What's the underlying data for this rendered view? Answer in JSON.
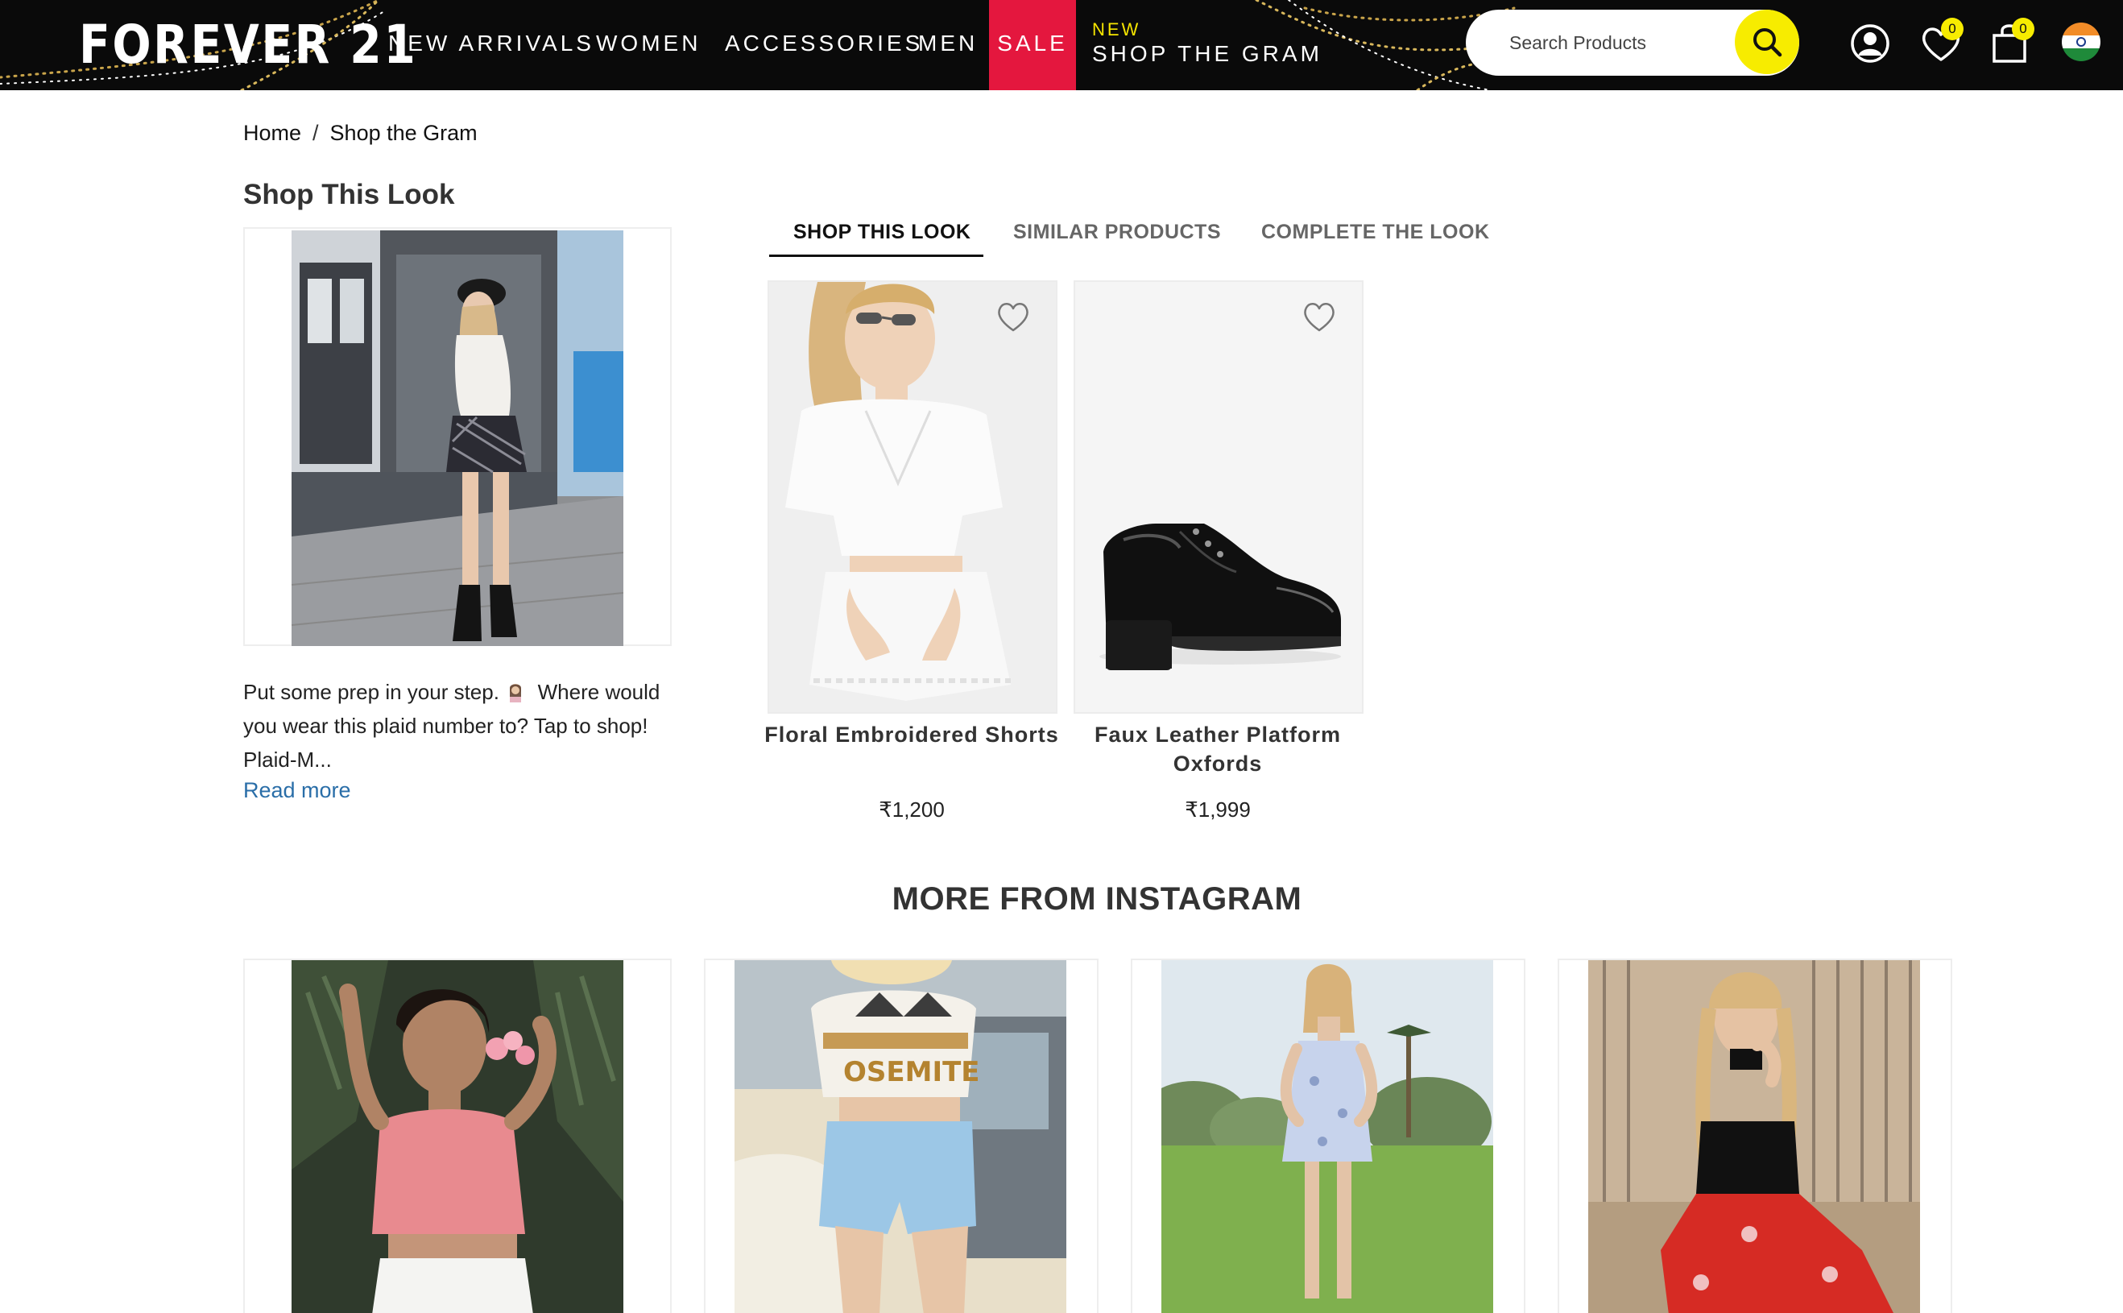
{
  "header": {
    "logo": "FOREVER 21",
    "nav": [
      "NEW ARRIVALS",
      "WOMEN",
      "ACCESSORIES",
      "MEN",
      "SALE"
    ],
    "gram_new": "NEW",
    "gram_label": "SHOP THE GRAM",
    "search_placeholder": "Search Products",
    "wishlist_count": "0",
    "cart_count": "0",
    "icons": [
      "account-icon",
      "wishlist-heart-icon",
      "shopping-bag-icon",
      "india-flag-icon",
      "search-icon"
    ],
    "colors": {
      "bar": "#0a0a0a",
      "sale": "#e4173e",
      "accent": "#f7ec00"
    }
  },
  "breadcrumb": {
    "home": "Home",
    "separator": "/",
    "current": "Shop the Gram"
  },
  "look": {
    "title": "Shop This Look",
    "caption_before": "Put some prep in your step.",
    "caption_after": "Where would you wear this plaid number to? Tap to shop! Plaid-M...",
    "read_more": "Read more"
  },
  "tabs": [
    {
      "label": "SHOP THIS LOOK",
      "active": true
    },
    {
      "label": "SIMILAR PRODUCTS",
      "active": false
    },
    {
      "label": "COMPLETE THE LOOK",
      "active": false
    }
  ],
  "products": [
    {
      "name": "Floral Embroidered Shorts",
      "price": "₹1,200"
    },
    {
      "name": "Faux Leather Platform Oxfords",
      "price": "₹1,999"
    }
  ],
  "more": {
    "title": "MORE FROM INSTAGRAM"
  }
}
